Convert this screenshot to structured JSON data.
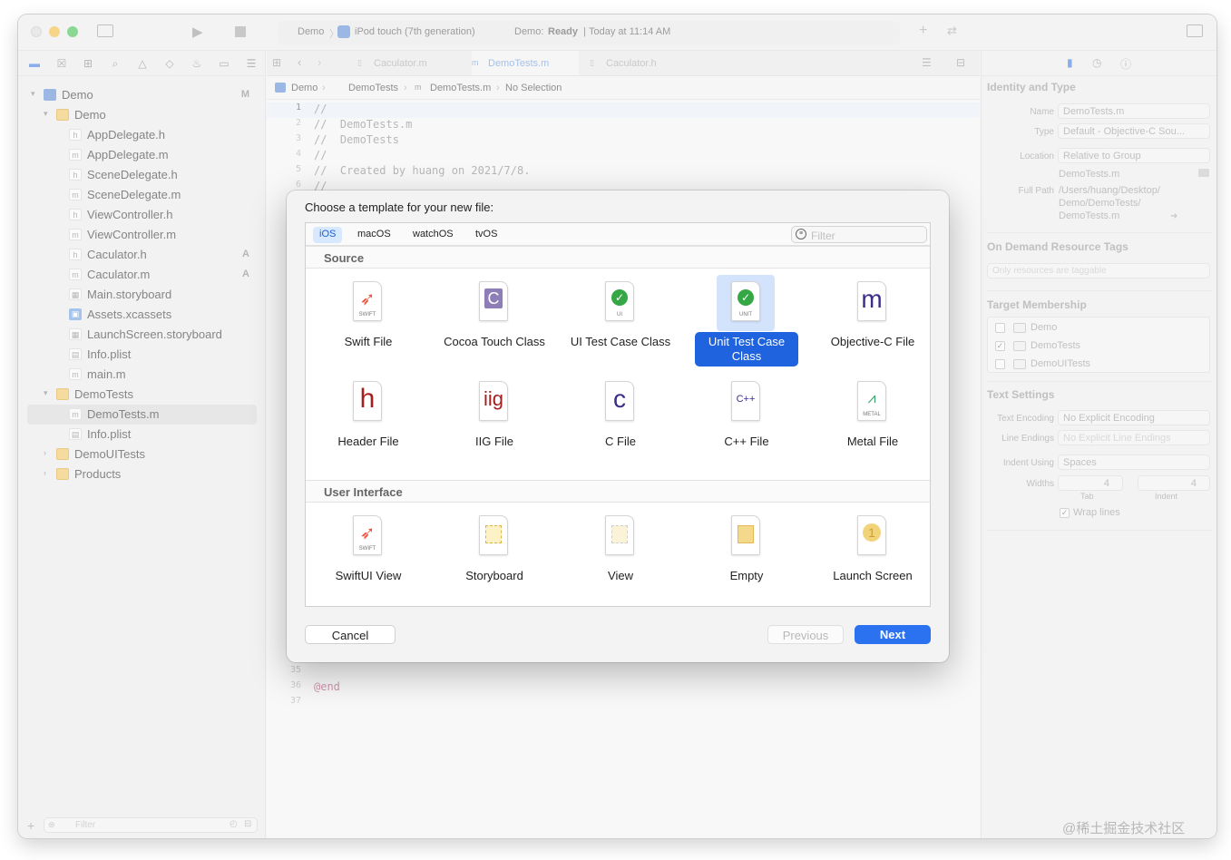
{
  "toolbar": {
    "scheme": "Demo",
    "device": "iPod touch (7th generation)",
    "status_prefix": "Demo: ",
    "status_state": "Ready",
    "status_time": "Today at 11:14 AM"
  },
  "tabs": [
    "Caculator.m",
    "DemoTests.m",
    "Caculator.h"
  ],
  "jumpbar": [
    "Demo",
    "DemoTests",
    "DemoTests.m",
    "No Selection"
  ],
  "navigator": {
    "items": [
      {
        "label": "Demo",
        "status": "M"
      },
      {
        "label": "Demo",
        "status": ""
      },
      {
        "label": "AppDelegate.h",
        "status": ""
      },
      {
        "label": "AppDelegate.m",
        "status": ""
      },
      {
        "label": "SceneDelegate.h",
        "status": ""
      },
      {
        "label": "SceneDelegate.m",
        "status": ""
      },
      {
        "label": "ViewController.h",
        "status": ""
      },
      {
        "label": "ViewController.m",
        "status": ""
      },
      {
        "label": "Caculator.h",
        "status": "A"
      },
      {
        "label": "Caculator.m",
        "status": "A"
      },
      {
        "label": "Main.storyboard",
        "status": ""
      },
      {
        "label": "Assets.xcassets",
        "status": ""
      },
      {
        "label": "LaunchScreen.storyboard",
        "status": ""
      },
      {
        "label": "Info.plist",
        "status": ""
      },
      {
        "label": "main.m",
        "status": ""
      },
      {
        "label": "DemoTests",
        "status": ""
      },
      {
        "label": "DemoTests.m",
        "status": ""
      },
      {
        "label": "Info.plist",
        "status": ""
      },
      {
        "label": "DemoUITests",
        "status": ""
      },
      {
        "label": "Products",
        "status": ""
      }
    ],
    "filter_placeholder": "Filter"
  },
  "code": {
    "lines": [
      {
        "n": "1",
        "t": "//"
      },
      {
        "n": "2",
        "t": "//  DemoTests.m"
      },
      {
        "n": "3",
        "t": "//  DemoTests"
      },
      {
        "n": "4",
        "t": "//"
      },
      {
        "n": "5",
        "t": "//  Created by huang on 2021/7/8."
      },
      {
        "n": "6",
        "t": "//"
      }
    ],
    "tail_lines": [
      {
        "n": "35",
        "t": ""
      },
      {
        "n": "36",
        "t": "@end"
      },
      {
        "n": "37",
        "t": ""
      }
    ]
  },
  "inspector": {
    "identity_header": "Identity and Type",
    "name_label": "Name",
    "name_value": "DemoTests.m",
    "type_label": "Type",
    "type_value": "Default - Objective-C Sou...",
    "location_label": "Location",
    "location_value": "Relative to Group",
    "location_file": "DemoTests.m",
    "fullpath_label": "Full Path",
    "fullpath_lines": [
      "/Users/huang/Desktop/",
      "Demo/DemoTests/",
      "DemoTests.m"
    ],
    "odr_header": "On Demand Resource Tags",
    "odr_placeholder": "Only resources are taggable",
    "target_header": "Target Membership",
    "targets": [
      {
        "label": "Demo",
        "checked": false
      },
      {
        "label": "DemoTests",
        "checked": true
      },
      {
        "label": "DemoUITests",
        "checked": false
      }
    ],
    "text_header": "Text Settings",
    "encoding_label": "Text Encoding",
    "encoding_value": "No Explicit Encoding",
    "endings_label": "Line Endings",
    "endings_value": "No Explicit Line Endings",
    "indent_label": "Indent Using",
    "indent_value": "Spaces",
    "widths_label": "Widths",
    "tab_value": "4",
    "indent_value_num": "4",
    "tab_caption": "Tab",
    "indent_caption": "Indent",
    "wrap_label": "Wrap lines"
  },
  "dialog": {
    "title": "Choose a template for your new file:",
    "platforms": [
      "iOS",
      "macOS",
      "watchOS",
      "tvOS"
    ],
    "selected_platform": "iOS",
    "filter_placeholder": "Filter",
    "sections": [
      {
        "header": "Source",
        "items": [
          {
            "label": "Swift File",
            "glyph": "SWIFT",
            "icon": "swift-file-icon"
          },
          {
            "label": "Cocoa Touch Class",
            "glyph": "C",
            "icon": "cocoa-touch-class-icon"
          },
          {
            "label": "UI Test Case Class",
            "glyph": "UI",
            "icon": "ui-test-case-icon"
          },
          {
            "label": "Unit Test Case Class",
            "glyph": "UNIT",
            "icon": "unit-test-case-icon",
            "selected": true
          },
          {
            "label": "Objective-C File",
            "glyph": "m",
            "icon": "objective-c-file-icon"
          },
          {
            "label": "Header File",
            "glyph": "h",
            "icon": "header-file-icon"
          },
          {
            "label": "IIG File",
            "glyph": "iig",
            "icon": "iig-file-icon"
          },
          {
            "label": "C File",
            "glyph": "c",
            "icon": "c-file-icon"
          },
          {
            "label": "C++ File",
            "glyph": "C++",
            "icon": "cpp-file-icon"
          },
          {
            "label": "Metal File",
            "glyph": "METAL",
            "icon": "metal-file-icon"
          }
        ]
      },
      {
        "header": "User Interface",
        "items": [
          {
            "label": "SwiftUI View",
            "glyph": "SWIFT",
            "icon": "swiftui-view-icon"
          },
          {
            "label": "Storyboard",
            "glyph": "",
            "icon": "storyboard-icon"
          },
          {
            "label": "View",
            "glyph": "",
            "icon": "view-icon"
          },
          {
            "label": "Empty",
            "glyph": "",
            "icon": "empty-icon"
          },
          {
            "label": "Launch Screen",
            "glyph": "1",
            "icon": "launch-screen-icon"
          }
        ]
      }
    ],
    "buttons": {
      "cancel": "Cancel",
      "previous": "Previous",
      "next": "Next"
    }
  },
  "watermark": "@稀土掘金技术社区",
  "colors": {
    "accent": "#1f63de",
    "selection": "#d3e3fb",
    "folder": "#f6c85f"
  }
}
